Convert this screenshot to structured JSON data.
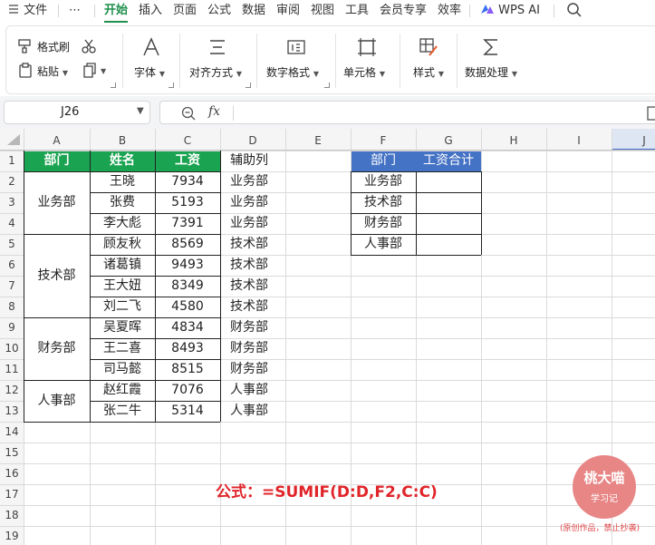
{
  "menubar": {
    "items": [
      "文件",
      "⋯",
      "开始",
      "插入",
      "页面",
      "公式",
      "数据",
      "审阅",
      "视图",
      "工具",
      "会员专享",
      "效率"
    ],
    "active": "开始",
    "wps_ai": "WPS AI"
  },
  "ribbon": {
    "format_painter": "格式刷",
    "paste": "粘贴",
    "font": "字体",
    "align": "对齐方式",
    "number_format": "数字格式",
    "cell": "单元格",
    "style": "样式",
    "data_process": "数据处理"
  },
  "formula_bar": {
    "name_box": "J26",
    "fx": "fx",
    "value": ""
  },
  "columns": [
    "A",
    "B",
    "C",
    "D",
    "E",
    "F",
    "G",
    "H",
    "I",
    "J"
  ],
  "rows": [
    "1",
    "2",
    "3",
    "4",
    "5",
    "6",
    "7",
    "8",
    "9",
    "10",
    "11",
    "12",
    "13",
    "14",
    "15",
    "16",
    "17",
    "18",
    "19"
  ],
  "table": {
    "headers": [
      "部门",
      "姓名",
      "工资"
    ],
    "groups": [
      {
        "dept": "业务部",
        "people": [
          [
            "王晓",
            "7934"
          ],
          [
            "张费",
            "5193"
          ],
          [
            "李大彪",
            "7391"
          ]
        ]
      },
      {
        "dept": "技术部",
        "people": [
          [
            "顾友秋",
            "8569"
          ],
          [
            "诸葛镇",
            "9493"
          ],
          [
            "王大妞",
            "8349"
          ],
          [
            "刘二飞",
            "4580"
          ]
        ]
      },
      {
        "dept": "财务部",
        "people": [
          [
            "吴夏晖",
            "4834"
          ],
          [
            "王二喜",
            "8493"
          ],
          [
            "司马懿",
            "8515"
          ]
        ]
      },
      {
        "dept": "人事部",
        "people": [
          [
            "赵红霞",
            "7076"
          ],
          [
            "张二牛",
            "5314"
          ]
        ]
      }
    ]
  },
  "helper": {
    "header": "辅助列",
    "values": [
      "业务部",
      "业务部",
      "业务部",
      "技术部",
      "技术部",
      "技术部",
      "技术部",
      "财务部",
      "财务部",
      "财务部",
      "人事部",
      "人事部"
    ]
  },
  "summary": {
    "headers": [
      "部门",
      "工资合计"
    ],
    "depts": [
      "业务部",
      "技术部",
      "财务部",
      "人事部"
    ],
    "totals": [
      "",
      "",
      "",
      ""
    ]
  },
  "formula_note": "公式：=SUMIF(D:D,F2,C:C)",
  "watermark": {
    "title": "桃大喵",
    "sub": "学习记",
    "note": "(原创作品，禁止抄袭)"
  },
  "colors": {
    "green_header": "#1aa350",
    "blue_header": "#4472c4",
    "active_tab": "#1e8f4c",
    "formula_red": "#e0252a",
    "stamp": "#e88585"
  }
}
